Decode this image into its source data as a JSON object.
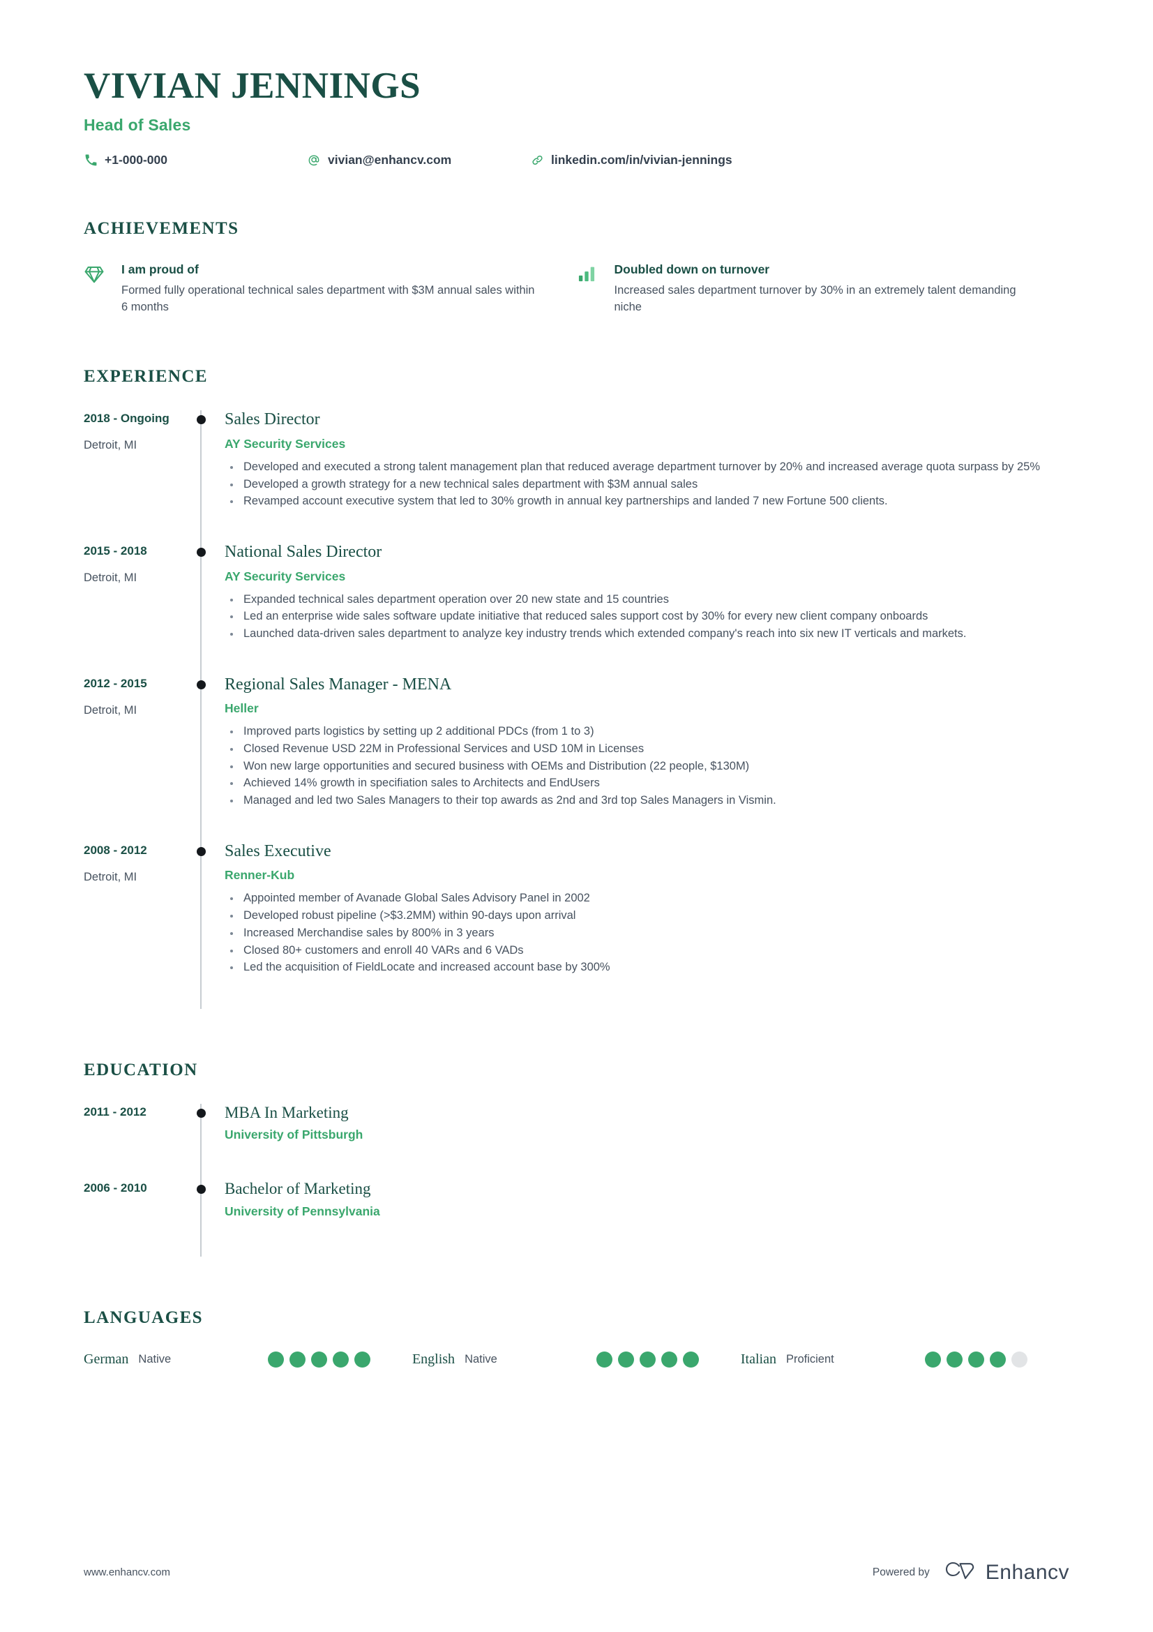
{
  "header": {
    "name": "VIVIAN JENNINGS",
    "job_title": "Head of Sales",
    "contacts": [
      {
        "icon": "phone-icon",
        "text": "+1-000-000"
      },
      {
        "icon": "at-sign-icon",
        "text": "vivian@enhancv.com"
      },
      {
        "icon": "link-icon",
        "text": "linkedin.com/in/vivian-jennings"
      }
    ]
  },
  "achievements": {
    "title": "ACHIEVEMENTS",
    "items": [
      {
        "icon": "diamond-icon",
        "title": "I am proud of",
        "description": "Formed fully operational technical sales department with $3M annual sales within 6 months"
      },
      {
        "icon": "bar-chart-icon",
        "title": "Doubled down on turnover",
        "description": "Increased sales department turnover by 30% in an extremely talent demanding niche"
      }
    ]
  },
  "experience": {
    "title": "EXPERIENCE",
    "entries": [
      {
        "date": "2018 - Ongoing",
        "location": "Detroit, MI",
        "role": "Sales Director",
        "company": "AY Security Services",
        "bullets": [
          "Developed and executed a strong talent management plan that reduced average department turnover by 20% and increased average quota surpass by 25%",
          "Developed a growth strategy for a new technical sales department with $3M annual sales",
          "Revamped account executive system that led to 30% growth in annual key partnerships and landed 7 new Fortune 500 clients."
        ]
      },
      {
        "date": "2015 - 2018",
        "location": "Detroit, MI",
        "role": "National Sales Director",
        "company": "AY Security Services",
        "bullets": [
          "Expanded technical sales department operation over 20 new state and 15 countries",
          "Led an enterprise wide sales software update initiative that reduced sales support cost by 30% for every new client company onboards",
          "Launched data-driven sales department to analyze key industry trends which extended company's reach into six new IT verticals and markets."
        ]
      },
      {
        "date": "2012 - 2015",
        "location": "Detroit, MI",
        "role": "Regional Sales Manager - MENA",
        "company": "Heller",
        "bullets": [
          "Improved parts logistics by setting up 2 additional PDCs (from 1 to 3)",
          "Closed Revenue USD 22M in Professional Services and USD 10M in Licenses",
          "Won new large opportunities and secured business with OEMs and Distribution (22 people, $130M)",
          "Achieved 14% growth in specifiation sales to Architects and EndUsers",
          "Managed and led two Sales Managers to their top awards as 2nd and 3rd top Sales Managers in Vismin."
        ]
      },
      {
        "date": "2008 - 2012",
        "location": "Detroit, MI",
        "role": "Sales Executive",
        "company": "Renner-Kub",
        "bullets": [
          "Appointed member of Avanade Global Sales Advisory Panel in 2002",
          "Developed robust pipeline (>$3.2MM) within 90-days upon arrival",
          "Increased Merchandise sales by 800% in 3 years",
          "Closed 80+ customers and enroll 40 VARs and 6 VADs",
          "Led the acquisition of FieldLocate and increased account base by 300%"
        ]
      }
    ]
  },
  "education": {
    "title": "EDUCATION",
    "entries": [
      {
        "date": "2011 - 2012",
        "degree": "MBA In Marketing",
        "school": "University of Pittsburgh"
      },
      {
        "date": "2006 - 2010",
        "degree": "Bachelor of Marketing",
        "school": "University of Pennsylvania"
      }
    ]
  },
  "languages": {
    "title": "LANGUAGES",
    "max_dots": 5,
    "items": [
      {
        "name": "German",
        "level": "Native",
        "filled": 5
      },
      {
        "name": "English",
        "level": "Native",
        "filled": 5
      },
      {
        "name": "Italian",
        "level": "Proficient",
        "filled": 4
      }
    ]
  },
  "footer": {
    "url": "www.enhancv.com",
    "powered_by": "Powered by",
    "brand": "Enhancv"
  },
  "colors": {
    "dark_teal": "#1a4f45",
    "green": "#3aa76d",
    "body_text": "#47525f",
    "dot_empty": "#e2e4e6",
    "rail": "#c7cdd2"
  }
}
